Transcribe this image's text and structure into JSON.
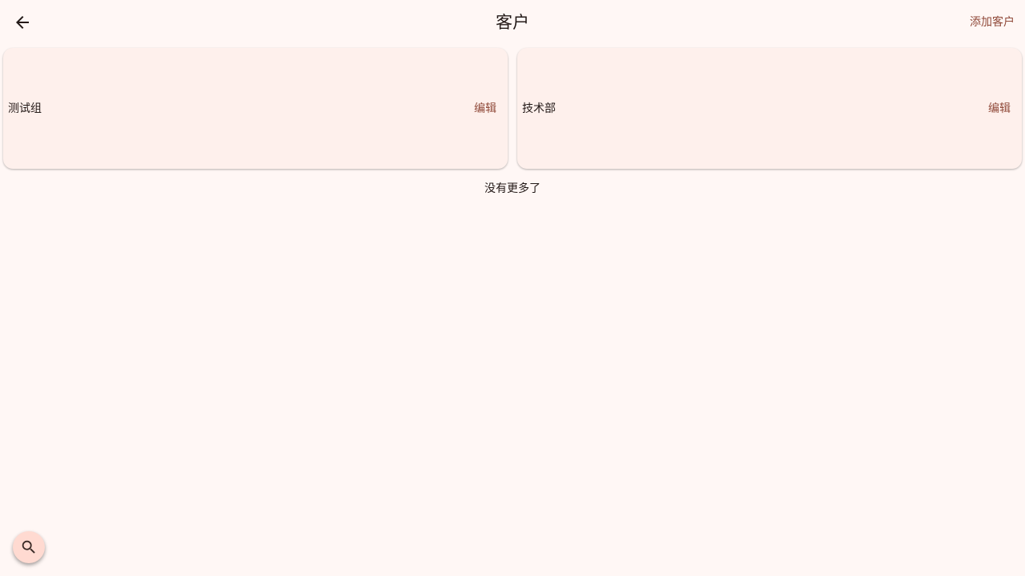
{
  "header": {
    "title": "客户",
    "back_icon": "arrow-back-icon",
    "add_label": "添加客户"
  },
  "customers": [
    {
      "name": "测试组",
      "edit_label": "编辑"
    },
    {
      "name": "技术部",
      "edit_label": "编辑"
    }
  ],
  "list_footer": "没有更多了",
  "fab": {
    "icon": "search-icon"
  },
  "colors": {
    "background": "#fff7f5",
    "card": "#fef0ec",
    "accent": "#904a3a",
    "fab": "#ffdad1",
    "text": "#231917"
  }
}
